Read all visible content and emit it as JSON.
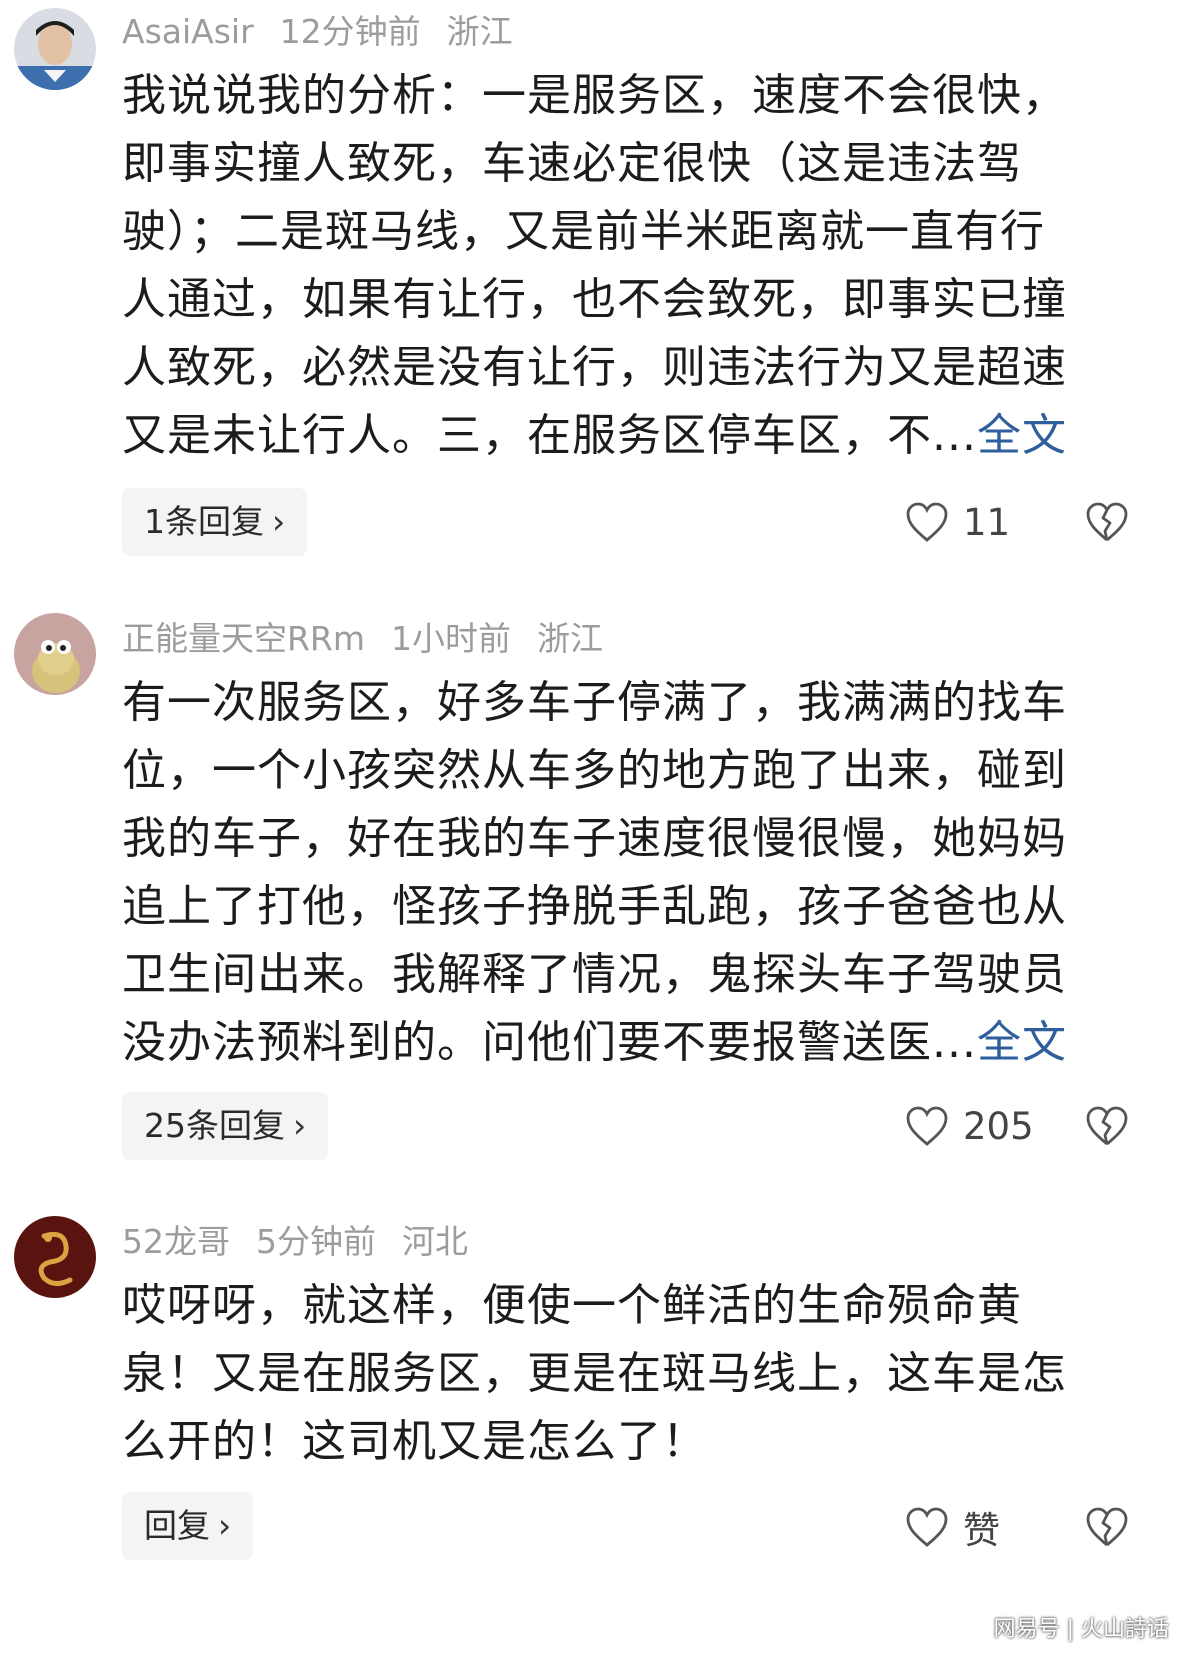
{
  "comments": [
    {
      "user": "AsaiAsir",
      "time": "12分钟前",
      "location": "浙江",
      "lines": [
        "我说说我的分析：一是服务区，速度不会很快，",
        "即事实撞人致死，车速必定很快（这是违法驾",
        "驶）；二是斑马线，又是前半米距离就一直有行",
        "人通过，如果有让行，也不会致死，即事实已撞",
        "人致死，必然是没有让行，则违法行为又是超速",
        "又是未让行人。三，在服务区停车区，不..."
      ],
      "more": "全文",
      "replies": "1条回复",
      "likes": "11"
    },
    {
      "user": "正能量天空RRm",
      "time": "1小时前",
      "location": "浙江",
      "lines": [
        "有一次服务区，好多车子停满了，我满满的找车",
        "位，一个小孩突然从车多的地方跑了出来，碰到",
        "我的车子，好在我的车子速度很慢很慢，她妈妈",
        "追上了打他，怪孩子挣脱手乱跑，孩子爸爸也从",
        "卫生间出来。我解释了情况，鬼探头车子驾驶员",
        "没办法预料到的。问他们要不要报警送医..."
      ],
      "more": "全文",
      "replies": "25条回复",
      "likes": "205"
    },
    {
      "user": "52龙哥",
      "time": "5分钟前",
      "location": "河北",
      "lines": [
        "哎呀呀，就这样，便使一个鲜活的生命殒命黄",
        "泉！又是在服务区，更是在斑马线上，这车是怎",
        "么开的！这司机又是怎么了！"
      ],
      "more": "",
      "replies": "回复",
      "likes": "赞"
    }
  ],
  "reply_chevron": "›",
  "watermark": "网易号 | 火山詩话",
  "icons": {
    "like": "heart-outline-icon",
    "dislike": "broken-heart-icon"
  },
  "colors": {
    "meta": "#9c9c9c",
    "link": "#2e5f9c",
    "reply_bg": "#f4f4f6"
  }
}
